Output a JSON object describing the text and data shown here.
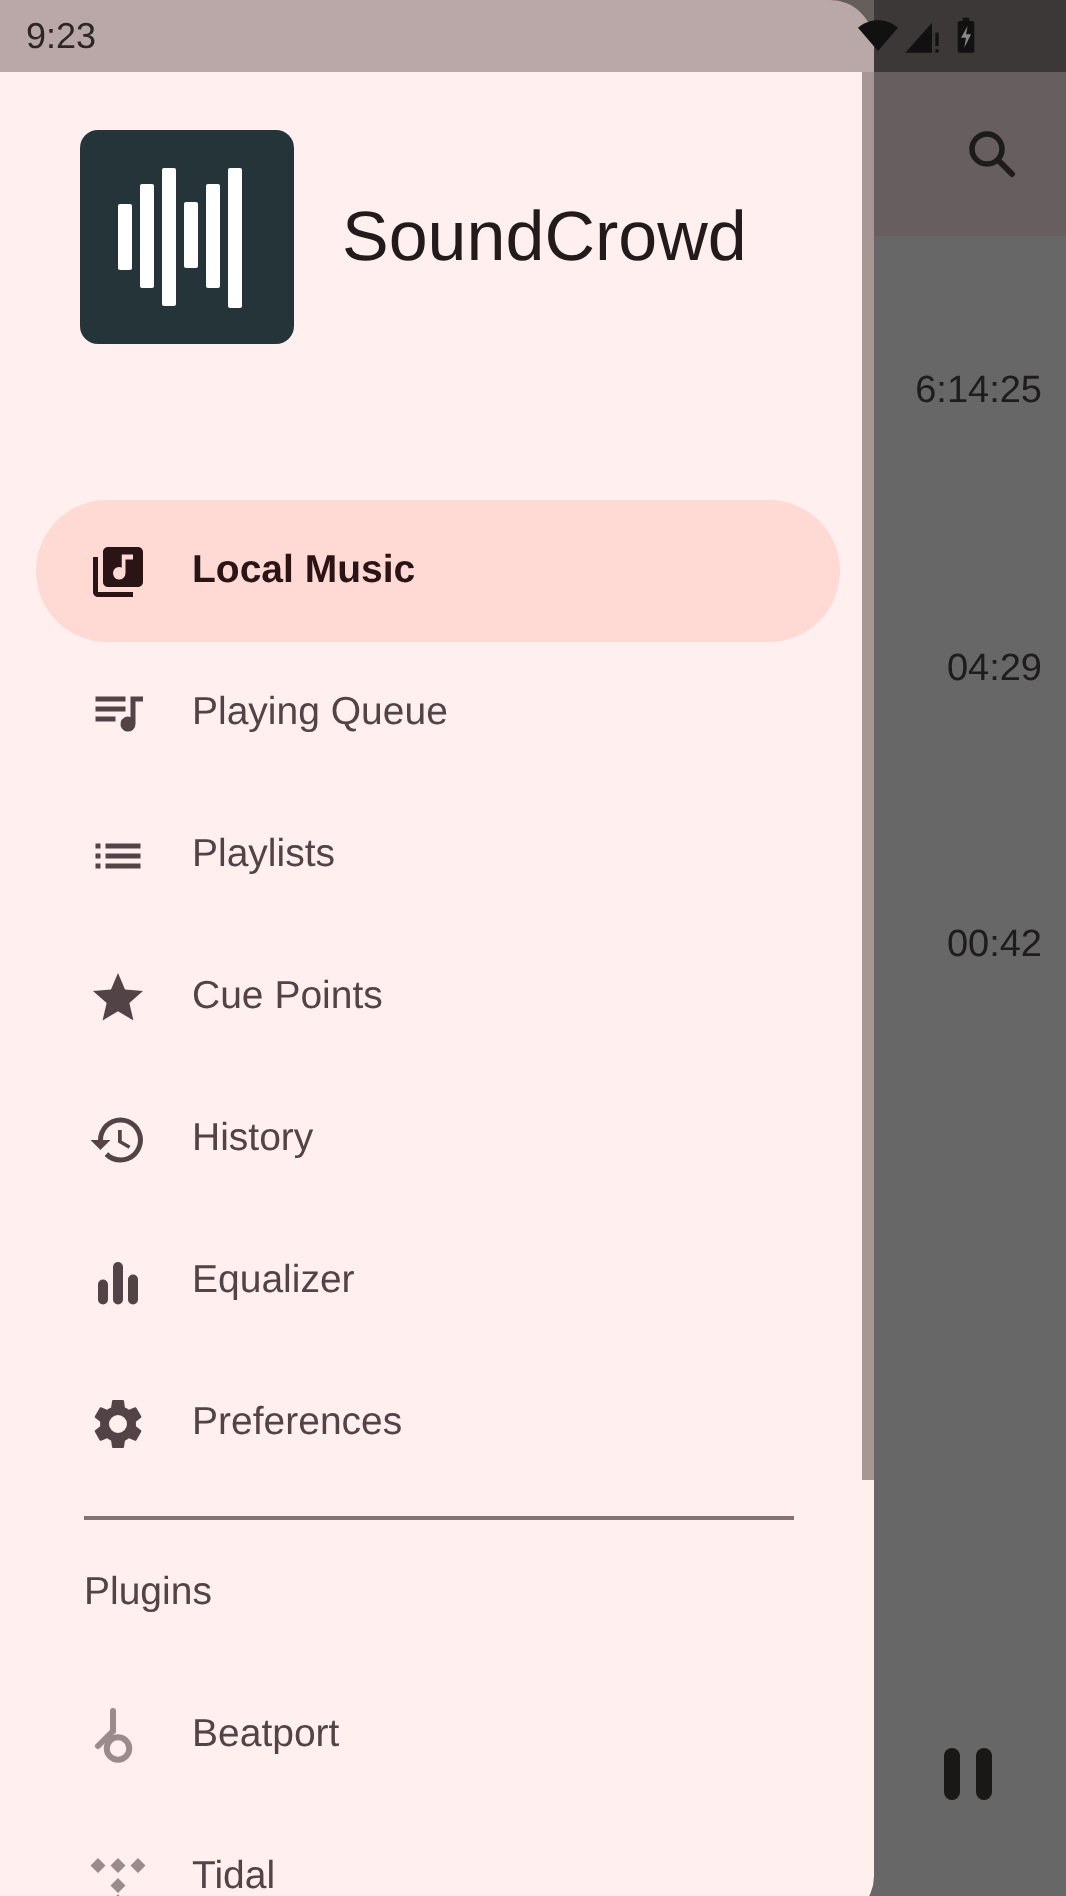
{
  "status_bar": {
    "time": "9:23"
  },
  "app": {
    "durations": [
      "6:14:25",
      "04:29",
      "00:42"
    ]
  },
  "drawer": {
    "title": "SoundCrowd",
    "items": [
      {
        "label": "Local Music",
        "kind": "library",
        "selected": true
      },
      {
        "label": "Playing Queue",
        "kind": "queue",
        "selected": false
      },
      {
        "label": "Playlists",
        "kind": "list",
        "selected": false
      },
      {
        "label": "Cue Points",
        "kind": "star",
        "selected": false
      },
      {
        "label": "History",
        "kind": "history",
        "selected": false
      },
      {
        "label": "Equalizer",
        "kind": "equalizer",
        "selected": false
      },
      {
        "label": "Preferences",
        "kind": "gear",
        "selected": false
      }
    ],
    "section": "Plugins",
    "plugins": [
      {
        "label": "Beatport",
        "kind": "beatport"
      },
      {
        "label": "Tidal",
        "kind": "tidal"
      }
    ]
  }
}
